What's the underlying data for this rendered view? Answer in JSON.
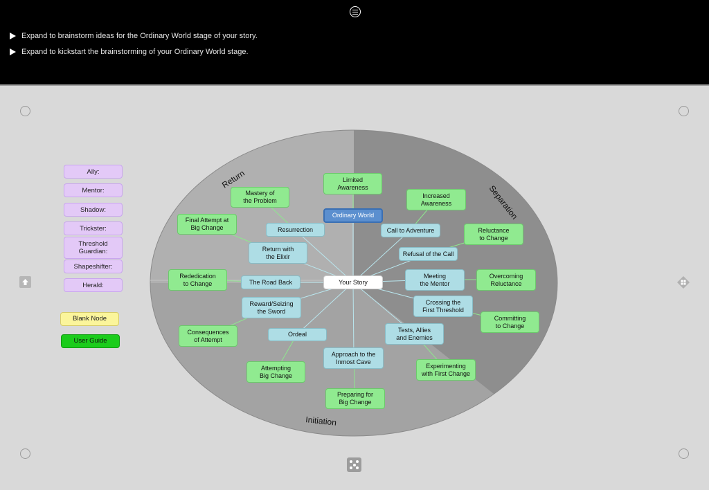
{
  "hints": [
    "Expand to brainstorm ideas for the Ordinary World stage of your story.",
    "Expand to kickstart the brainstorming of your Ordinary World stage."
  ],
  "palette": [
    "Ally:",
    "Mentor:",
    "Shadow:",
    "Trickster:",
    "Threshold\nGuardian:",
    "Shapeshifter:",
    "Herald:"
  ],
  "blank_node": "Blank Node",
  "user_guide": "User Guide",
  "regions": {
    "return": "Return",
    "separation": "Separation",
    "initiation": "Initiation"
  },
  "nodes": {
    "your_story": "Your Story",
    "ordinary_world": "Ordinary World",
    "limited_awareness": "Limited\nAwareness",
    "call_to_adventure": "Call to Adventure",
    "increased_awareness": "Increased\nAwareness",
    "refusal_of_the_call": "Refusal of the Call",
    "reluctance_to_change": "Reluctance\nto Change",
    "meeting_the_mentor": "Meeting\nthe Mentor",
    "overcoming_reluctance": "Overcoming\nReluctance",
    "crossing_the_first_threshold": "Crossing the\nFirst Threshold",
    "committing_to_change": "Committing\nto Change",
    "tests_allies_and_enemies": "Tests, Allies\nand Enemies",
    "experimenting_with_first_change": "Experimenting\nwith First Change",
    "approach_to_the_inmost_cave": "Approach to the\nInmost Cave",
    "preparing_for_big_change": "Preparing for\nBig Change",
    "ordeal": "Ordeal",
    "attempting_big_change": "Attempting\nBig Change",
    "reward_seizing_the_sword": "Reward/Seizing\nthe Sword",
    "consequences_of_attempt": "Consequences\nof Attempt",
    "the_road_back": "The Road Back",
    "rededication_to_change": "Rededication\nto Change",
    "resurrection": "Resurrection",
    "final_attempt_at_big_change": "Final Attempt at\nBig Change",
    "return_with_the_elixir": "Return with\nthe Elixir",
    "mastery_of_the_problem": "Mastery of\nthe Problem"
  },
  "colors": {
    "stage_node": "#aedde5",
    "change_node": "#90ea90",
    "selected_node": "#5b8fcf",
    "character_palette": "#e3c9f7",
    "blank_node": "#fbf59b",
    "user_guide": "#1bcc1b"
  }
}
